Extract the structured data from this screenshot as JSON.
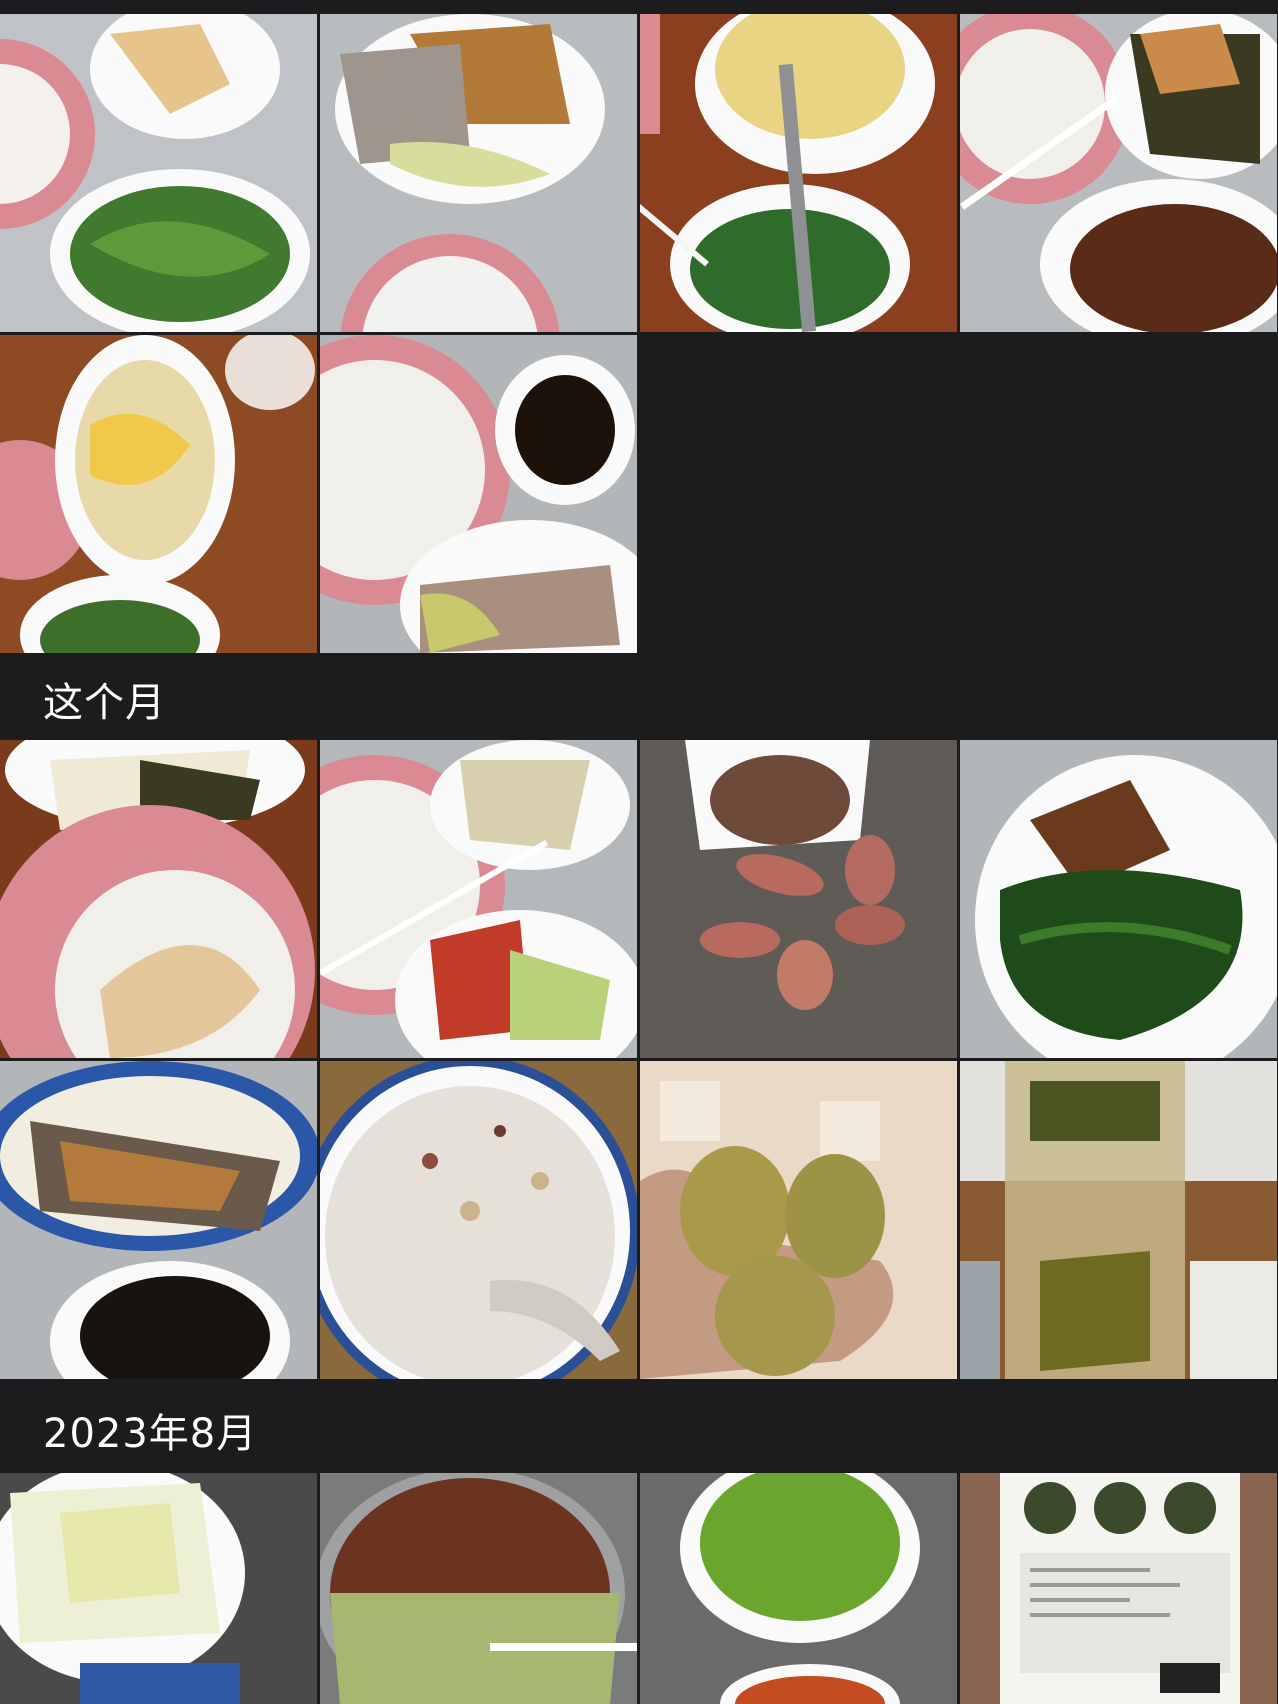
{
  "sections": [
    {
      "title": ""
    },
    {
      "title": "这个月"
    },
    {
      "title": "2023年8月"
    }
  ],
  "photos": {
    "top_group": [
      {
        "icon": "plate-rice-greens"
      },
      {
        "icon": "plate-meat-stew"
      },
      {
        "icon": "bowl-corn-porridge"
      },
      {
        "icon": "plate-braised-pork"
      },
      {
        "icon": "plate-mushroom-egg"
      },
      {
        "icon": "plate-rice-sauce"
      }
    ],
    "this_month": [
      {
        "icon": "tofu-chicken"
      },
      {
        "icon": "rice-chicken-tomato"
      },
      {
        "icon": "sweet-potatoes"
      },
      {
        "icon": "duck-greens"
      },
      {
        "icon": "fish-fungus"
      },
      {
        "icon": "oat-porridge"
      },
      {
        "icon": "kiwi-hand"
      },
      {
        "icon": "tea-bottle"
      }
    ],
    "aug_2023": [
      {
        "icon": "napa-cabbage"
      },
      {
        "icon": "beef-noodles"
      },
      {
        "icon": "green-beans"
      },
      {
        "icon": "milk-bottle"
      }
    ]
  },
  "colors": {
    "background": "#1c1c1e",
    "header_text": "#ffffff"
  }
}
